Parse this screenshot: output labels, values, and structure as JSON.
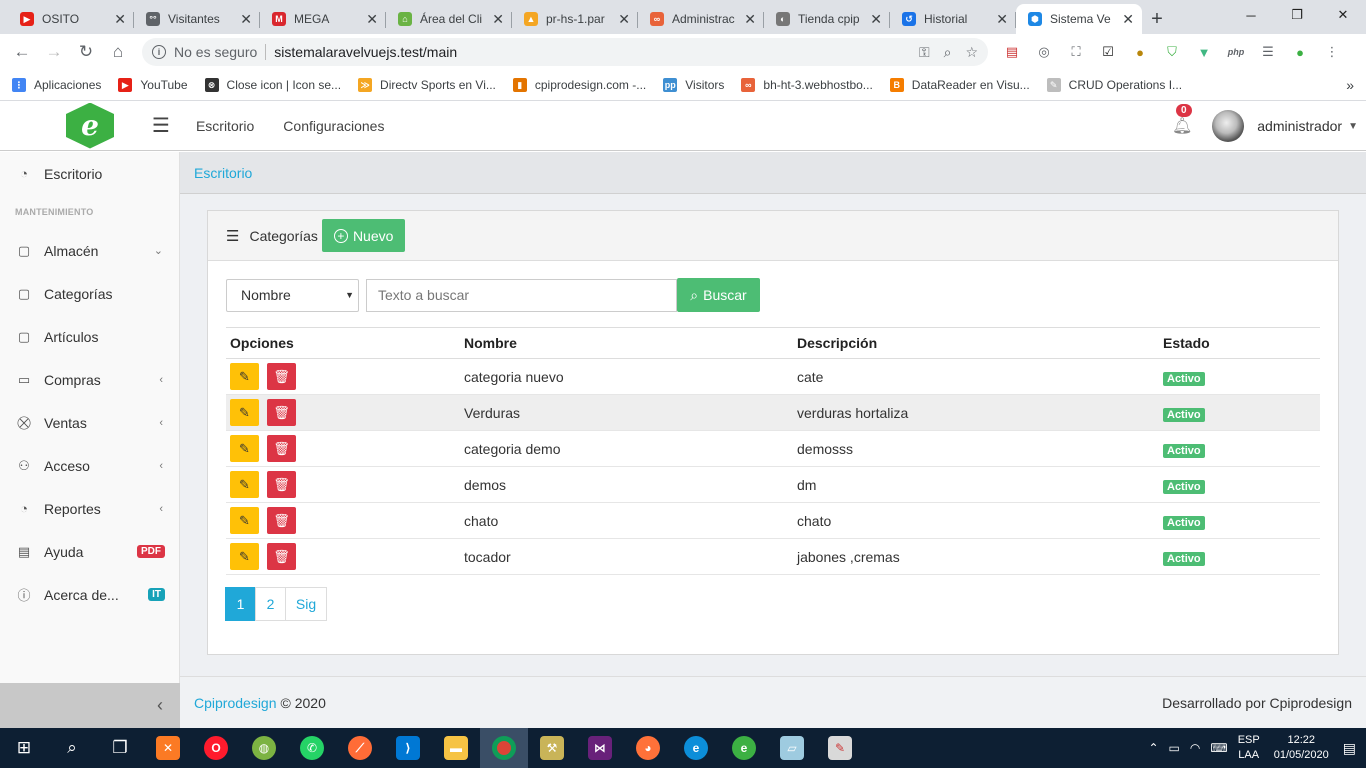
{
  "browser": {
    "tabs": [
      {
        "title": "OSITO",
        "color": "#e62117",
        "glyph": "▶"
      },
      {
        "title": "Visitantes",
        "color": "#5f6368",
        "glyph": "°°"
      },
      {
        "title": "MEGA",
        "color": "#d9272e",
        "glyph": "M"
      },
      {
        "title": "Área del Cli",
        "color": "#6ab344",
        "glyph": "⌂"
      },
      {
        "title": "pr-hs-1.par",
        "color": "#f4a623",
        "glyph": "▲"
      },
      {
        "title": "Administrac",
        "color": "#e8633a",
        "glyph": "∞"
      },
      {
        "title": "Tienda cpip",
        "color": "#777777",
        "glyph": "◐"
      },
      {
        "title": "Historial",
        "color": "#1a73e8",
        "glyph": "↺"
      },
      {
        "title": "Sistema Ve",
        "color": "#1e88e5",
        "glyph": "⬢"
      }
    ],
    "address": {
      "security": "No es seguro",
      "url": "sistemalaravelvuejs.test/main"
    },
    "bookmarks": [
      {
        "label": "Aplicaciones",
        "color": "#4285f4",
        "glyph": "⋮"
      },
      {
        "label": "YouTube",
        "color": "#e62117",
        "glyph": "▶"
      },
      {
        "label": "Close icon | Icon se...",
        "color": "#333333",
        "glyph": "⊗"
      },
      {
        "label": "Directv Sports en Vi...",
        "color": "#f4a623",
        "glyph": "≫"
      },
      {
        "label": "cpiprodesign.com -...",
        "color": "#e37400",
        "glyph": "▮"
      },
      {
        "label": "Visitors",
        "color": "#3f8fd2",
        "glyph": "pp"
      },
      {
        "label": "bh-ht-3.webhostbo...",
        "color": "#e8633a",
        "glyph": "∞"
      },
      {
        "label": "DataReader en Visu...",
        "color": "#f57d00",
        "glyph": "B"
      },
      {
        "label": "CRUD Operations I...",
        "color": "#bdbdbd",
        "glyph": "✎"
      }
    ]
  },
  "app": {
    "topnav": [
      "Escritorio",
      "Configuraciones"
    ],
    "notifications": "0",
    "username": "administrador",
    "sidebar": {
      "top": "Escritorio",
      "section": "MANTENIMIENTO",
      "items": [
        {
          "label": "Almacén",
          "icon": "▢",
          "arrow": "⌄"
        },
        {
          "label": "Categorías",
          "icon": "▢",
          "arrow": ""
        },
        {
          "label": "Artículos",
          "icon": "▢",
          "arrow": ""
        },
        {
          "label": "Compras",
          "icon": "▭",
          "arrow": "‹"
        },
        {
          "label": "Ventas",
          "icon": "⛒",
          "arrow": "‹"
        },
        {
          "label": "Acceso",
          "icon": "⚇",
          "arrow": "‹"
        },
        {
          "label": "Reportes",
          "icon": "◔",
          "arrow": "‹"
        }
      ],
      "ayuda": {
        "label": "Ayuda",
        "pill": "PDF",
        "pill_color": "#dc3545"
      },
      "acerca": {
        "label": "Acerca de...",
        "pill": "IT",
        "pill_color": "#17a2b8"
      }
    },
    "breadcrumb": "Escritorio",
    "card": {
      "title": "Categorías",
      "new_label": "Nuevo",
      "filter_selected": "Nombre",
      "search_placeholder": "Texto a buscar",
      "search_label": "Buscar",
      "columns": [
        "Opciones",
        "Nombre",
        "Descripción",
        "Estado"
      ],
      "rows": [
        {
          "nombre": "categoria nuevo",
          "descripcion": "cate",
          "estado": "Activo"
        },
        {
          "nombre": "Verduras",
          "descripcion": "verduras hortaliza",
          "estado": "Activo"
        },
        {
          "nombre": "categoria demo",
          "descripcion": "demosss",
          "estado": "Activo"
        },
        {
          "nombre": "demos",
          "descripcion": "dm",
          "estado": "Activo"
        },
        {
          "nombre": "chato",
          "descripcion": "chato",
          "estado": "Activo"
        },
        {
          "nombre": "tocador",
          "descripcion": "jabones ,cremas",
          "estado": "Activo"
        }
      ],
      "pages": [
        "1",
        "2",
        "Sig"
      ]
    },
    "footer": {
      "brand": "Cpiprodesign",
      "copy": "© 2020",
      "right": "Desarrollado por Cpiprodesign"
    }
  },
  "taskbar": {
    "lang": "ESP",
    "lang2": "LAA",
    "time": "12:22",
    "date": "01/05/2020"
  },
  "colors": {
    "primary": "#20a8d8",
    "success": "#4dbd74",
    "warning": "#ffc107",
    "danger": "#dc3545"
  }
}
